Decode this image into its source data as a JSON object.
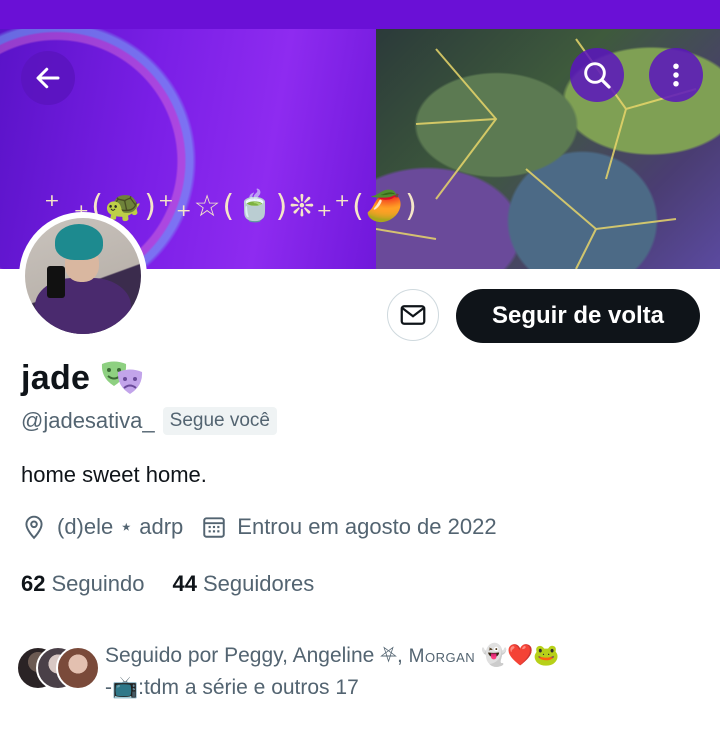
{
  "header": {
    "banner_emoji": "⁺ ₊(🐢)⁺₊☆(🍵)❊₊⁺(🥭)",
    "back_icon": "arrow-left-icon",
    "search_icon": "search-icon",
    "more_icon": "more-vertical-icon"
  },
  "actions": {
    "message_icon": "envelope-icon",
    "follow_back_label": "Seguir de volta"
  },
  "profile": {
    "name": "jade",
    "handle": "@jadesativa_",
    "follows_you": "Segue você",
    "bio": "home sweet home.",
    "location": "(d)ele ⋆ adrp",
    "joined": "Entrou em agosto de 2022"
  },
  "stats": {
    "following_count": "62",
    "following_label": "Seguindo",
    "followers_count": "44",
    "followers_label": "Seguidores"
  },
  "followed_by": {
    "prefix": "Seguido por Peggy, Angeline ⛧, ",
    "morgan": "Morgan",
    "emojis": "👻❤️🐸",
    "line2": "-📺:tdm a série e outros 17"
  },
  "colors": {
    "status_bar": "#6a10d6",
    "button_overlay": "#5a14be",
    "primary_text": "#0f1419",
    "secondary_text": "#536471"
  }
}
